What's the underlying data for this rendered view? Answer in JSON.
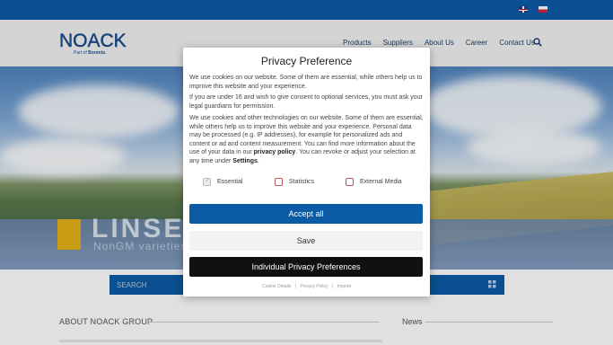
{
  "topbar": {
    "flags": [
      {
        "name": "english-flag"
      },
      {
        "name": "polish-flag"
      }
    ]
  },
  "header": {
    "logo": {
      "main": "NOACK",
      "sub_prefix": "Part of ",
      "sub_brand": "Borents."
    },
    "nav": [
      "Products",
      "Suppliers",
      "About Us",
      "Career",
      "Contact Us"
    ],
    "search_icon": "search-icon"
  },
  "hero": {
    "title": "LINSE",
    "subtitle": "NonGM varieties"
  },
  "searchbar": {
    "placeholder": "SEARCH"
  },
  "sections": {
    "about": "ABOUT NOACK GROUP",
    "news": "News"
  },
  "modal": {
    "title": "Privacy Preference",
    "p1": "We use cookies on our website. Some of them are essential, while others help us to improve this website and your experience.",
    "p2": "If you are under 16 and wish to give consent to optional services, you must ask your legal guardians for permission.",
    "p3_a": "We use cookies and other technologies on our website. Some of them are essential, while others help us to improve this website and your experience. Personal data may be processed (e.g. IP addresses), for example for personalized ads and content or ad and content measurement. You can find more information about the use of your data in our ",
    "p3_link1": "privacy policy",
    "p3_b": ". You can revoke or adjust your selection at any time under ",
    "p3_link2": "Settings",
    "p3_c": ".",
    "checkboxes": [
      {
        "label": "Essential",
        "checked": true,
        "disabled": true
      },
      {
        "label": "Statistics",
        "checked": false,
        "disabled": false
      },
      {
        "label": "External Media",
        "checked": false,
        "disabled": false
      }
    ],
    "buttons": {
      "accept_all": "Accept all",
      "save": "Save",
      "individual": "Individual Privacy Preferences"
    },
    "links": [
      "Cookie Details",
      "Privacy Policy",
      "Imprint"
    ],
    "link_separator": "|"
  },
  "colors": {
    "brand_blue": "#0b5ba5",
    "accent_yellow": "#e6b218",
    "dark_button": "#111111"
  }
}
